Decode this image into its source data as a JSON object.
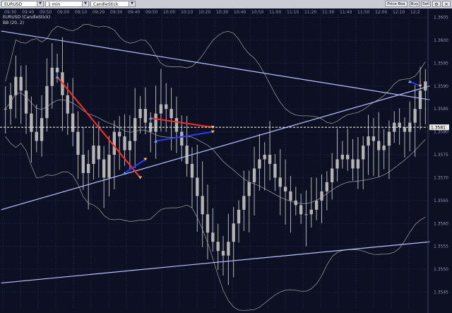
{
  "toolbar": {
    "symbol": "EURUSD",
    "interval": "1 min",
    "chart_style": "CandleStick",
    "buttons": [
      "Price Box",
      "Buy",
      "Sell"
    ]
  },
  "legend": {
    "symbol_line": "EURUSD (CandleStick)",
    "indicator_line": "BB (20, 2)"
  },
  "current_price_label": "1.3581",
  "colors": {
    "background": "#0d1023",
    "grid": "#1e2a4a",
    "candle": "#b4b4b4",
    "bollinger": "#b0b0b0",
    "trendline": "#b6c4ff",
    "red_marker": "#ff2a2a",
    "blue_marker": "#2a3aff",
    "price_line": "#ffffff"
  },
  "chart_data": {
    "type": "candlestick",
    "x_ticks": [
      "09:30",
      "09:40",
      "09:50",
      "09:00",
      "09:10",
      "09:20",
      "09:30",
      "09:40",
      "09:50",
      "10:00",
      "10:10",
      "10:20",
      "10:30",
      "10:40",
      "10:50",
      "11:00",
      "11:10",
      "11:20",
      "11:30",
      "11:40",
      "11:50",
      "12:00",
      "12:10",
      "12:2"
    ],
    "y_ticks": [
      "1.3605",
      "1.3600",
      "1.3595",
      "1.3590",
      "1.3585",
      "1.3580",
      "1.3575",
      "1.3570",
      "1.3565",
      "1.3560",
      "1.3555",
      "1.3550",
      "1.3545"
    ],
    "ylim": [
      1.3542,
      1.3606
    ],
    "close_series": [
      1.3585,
      1.3588,
      1.3592,
      1.3589,
      1.3584,
      1.358,
      1.3578,
      1.3583,
      1.359,
      1.3594,
      1.3593,
      1.3588,
      1.3584,
      1.358,
      1.3575,
      1.3571,
      1.3573,
      1.3577,
      1.3574,
      1.357,
      1.3575,
      1.358,
      1.3579,
      1.3576,
      1.3578,
      1.3583,
      1.3585,
      1.3582,
      1.358,
      1.3584,
      1.3586,
      1.3585,
      1.3583,
      1.358,
      1.3577,
      1.3573,
      1.357,
      1.3566,
      1.3562,
      1.3558,
      1.3556,
      1.3554,
      1.3553,
      1.3556,
      1.356,
      1.3563,
      1.3566,
      1.3569,
      1.3572,
      1.3574,
      1.3575,
      1.3573,
      1.357,
      1.3568,
      1.3567,
      1.3565,
      1.3564,
      1.3562,
      1.3562,
      1.3563,
      1.3565,
      1.3567,
      1.3569,
      1.3572,
      1.3574,
      1.3575,
      1.3574,
      1.3572,
      1.3574,
      1.3577,
      1.3579,
      1.3578,
      1.3576,
      1.3577,
      1.358,
      1.3582,
      1.3581,
      1.358,
      1.3582,
      1.3585,
      1.3589,
      1.3591
    ],
    "bollinger": "BB (20, 2)",
    "trendlines": [
      {
        "from": [
          0,
          1.3602
        ],
        "to": [
          81,
          1.3587
        ]
      },
      {
        "from": [
          0,
          1.3563
        ],
        "to": [
          81,
          1.359
        ]
      },
      {
        "from": [
          0,
          1.3547
        ],
        "to": [
          81,
          1.3556
        ]
      }
    ],
    "markers": [
      {
        "color": "red",
        "from": [
          10,
          1.3592
        ],
        "to": [
          26,
          1.357
        ]
      },
      {
        "color": "blue",
        "from": [
          23,
          1.3571
        ],
        "to": [
          27,
          1.3574
        ]
      },
      {
        "color": "red",
        "from": [
          28,
          1.3583
        ],
        "to": [
          40,
          1.3581
        ]
      },
      {
        "color": "blue",
        "from": [
          29,
          1.3578
        ],
        "to": [
          40,
          1.358
        ]
      },
      {
        "color": "blue",
        "from": [
          78,
          1.3591
        ],
        "to": [
          80,
          1.359
        ]
      }
    ]
  }
}
